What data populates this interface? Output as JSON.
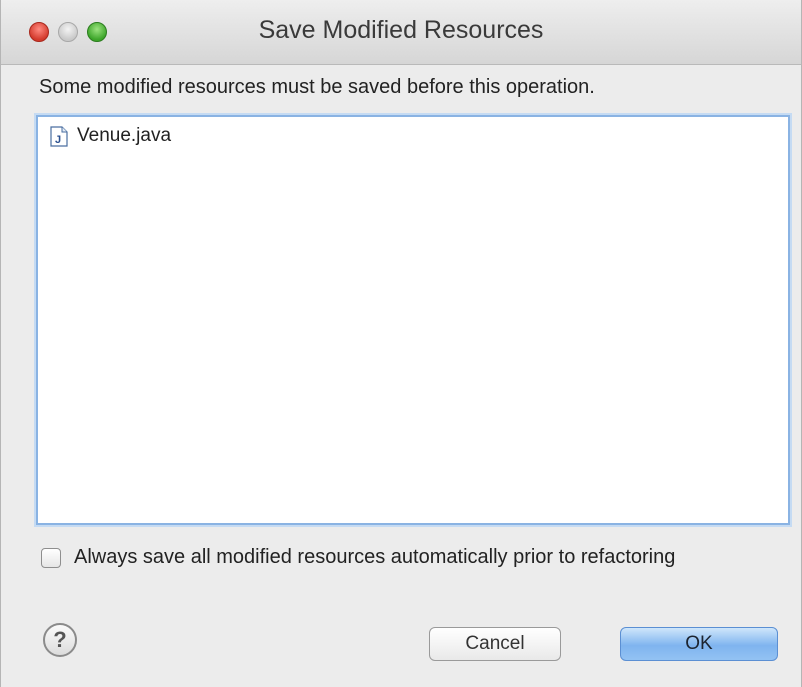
{
  "window": {
    "title": "Save Modified Resources"
  },
  "dialog": {
    "message": "Some modified resources must be saved before this operation.",
    "resources": [
      {
        "name": "Venue.java",
        "icon": "java-file-icon"
      }
    ],
    "checkbox": {
      "label": "Always save all modified resources automatically prior to refactoring",
      "checked": false
    },
    "help_glyph": "?",
    "buttons": {
      "cancel_label": "Cancel",
      "ok_label": "OK"
    }
  },
  "colors": {
    "titlebar": "#d6d6d6",
    "list_border": "#8ab3e3",
    "ok_button": "#7fb4ef",
    "close_light": "#d33a2c",
    "zoom_light": "#3da52a"
  }
}
